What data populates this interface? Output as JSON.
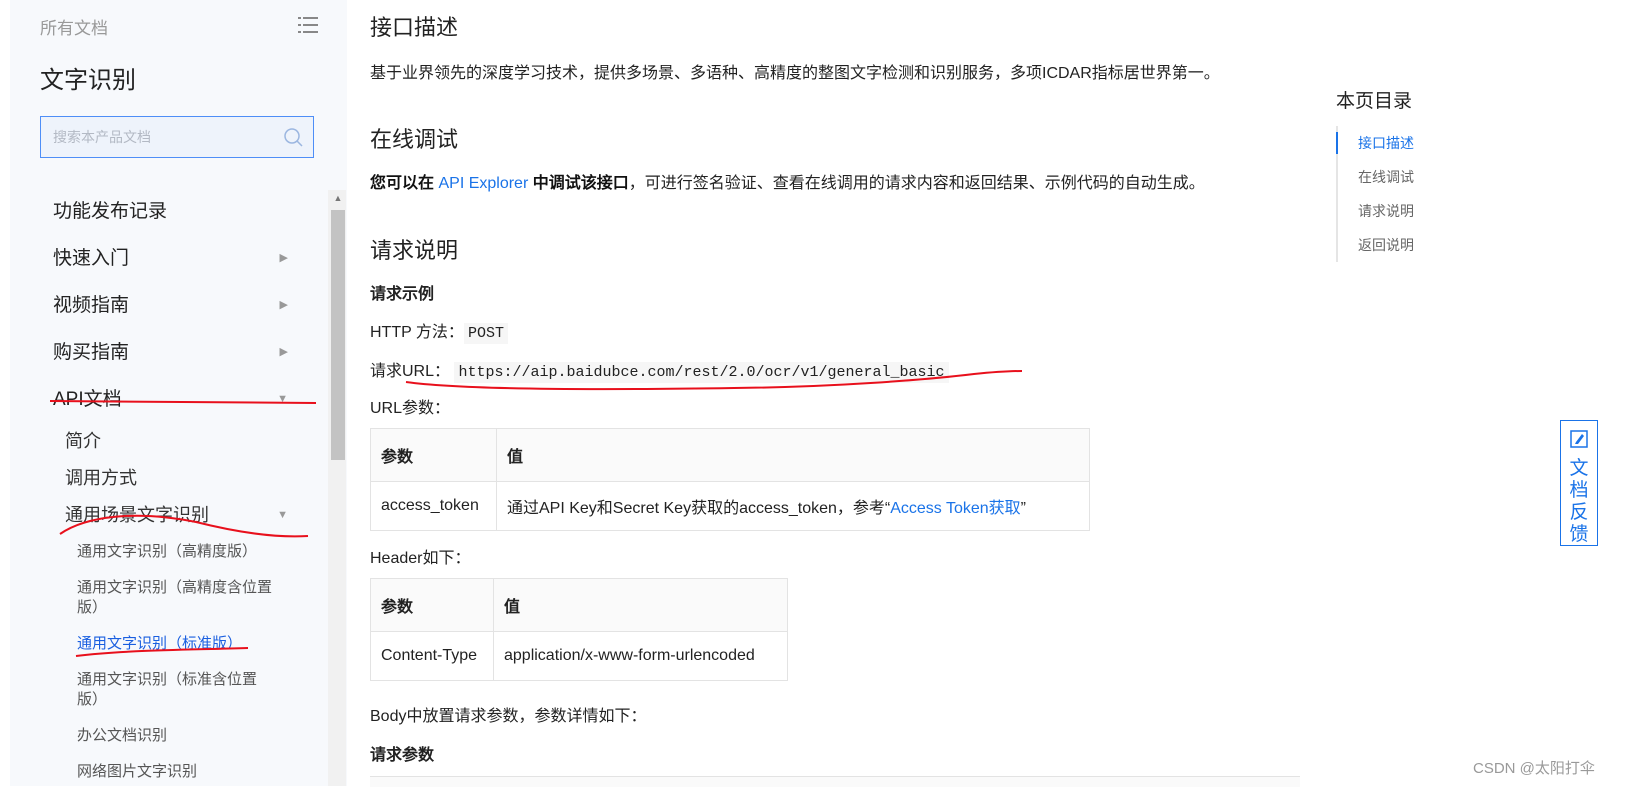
{
  "sidebar": {
    "all_docs": "所有文档",
    "product_title": "文字识别",
    "search_placeholder": "搜索本产品文档",
    "nav": [
      {
        "label": "功能发布记录",
        "arrow": ""
      },
      {
        "label": "快速入门",
        "arrow": "▶"
      },
      {
        "label": "视频指南",
        "arrow": "▶"
      },
      {
        "label": "购买指南",
        "arrow": "▶"
      },
      {
        "label": "API文档",
        "arrow": "▼"
      }
    ],
    "api_sub": [
      {
        "label": "简介",
        "arrow": ""
      },
      {
        "label": "调用方式",
        "arrow": ""
      },
      {
        "label": "通用场景文字识别",
        "arrow": "▼"
      }
    ],
    "leaves": [
      "通用文字识别（高精度版）",
      "通用文字识别（高精度含位置版）",
      "通用文字识别（标准版）",
      "通用文字识别（标准含位置版）",
      "办公文档识别",
      "网络图片文字识别"
    ]
  },
  "main": {
    "sec1_title": "接口描述",
    "sec1_desc": "基于业界领先的深度学习技术，提供多场景、多语种、高精度的整图文字检测和识别服务，多项ICDAR指标居世界第一。",
    "sec2_title": "在线调试",
    "sec2_bold1": "您可以在",
    "sec2_link": "API Explorer",
    "sec2_bold2": "中调试该接口",
    "sec2_rest": "，可进行签名验证、查看在线调用的请求内容和返回结果、示例代码的自动生成。",
    "sec3_title": "请求说明",
    "req_example": "请求示例",
    "http_label": "HTTP 方法：",
    "http_method": "POST",
    "url_label": "请求URL：",
    "url": "https://aip.baidubce.com/rest/2.0/ocr/v1/general_basic",
    "url_params": "URL参数：",
    "table1": {
      "h1": "参数",
      "h2": "值",
      "c1": "access_token",
      "c2_pre": "通过API Key和Secret Key获取的access_token，参考“",
      "c2_link": "Access Token获取",
      "c2_post": "”"
    },
    "header_label": "Header如下：",
    "table2": {
      "h1": "参数",
      "h2": "值",
      "c1": "Content-Type",
      "c2": "application/x-www-form-urlencoded"
    },
    "body_label": "Body中放置请求参数，参数详情如下：",
    "req_params": "请求参数"
  },
  "toc": {
    "title": "本页目录",
    "items": [
      "接口描述",
      "在线调试",
      "请求说明",
      "返回说明"
    ]
  },
  "feedback": {
    "label": "文档反馈"
  },
  "watermark": "CSDN @太阳打伞",
  "colors": {
    "link": "#1a73e8",
    "active": "#1a5fe0",
    "annotation": "#e8101c"
  }
}
